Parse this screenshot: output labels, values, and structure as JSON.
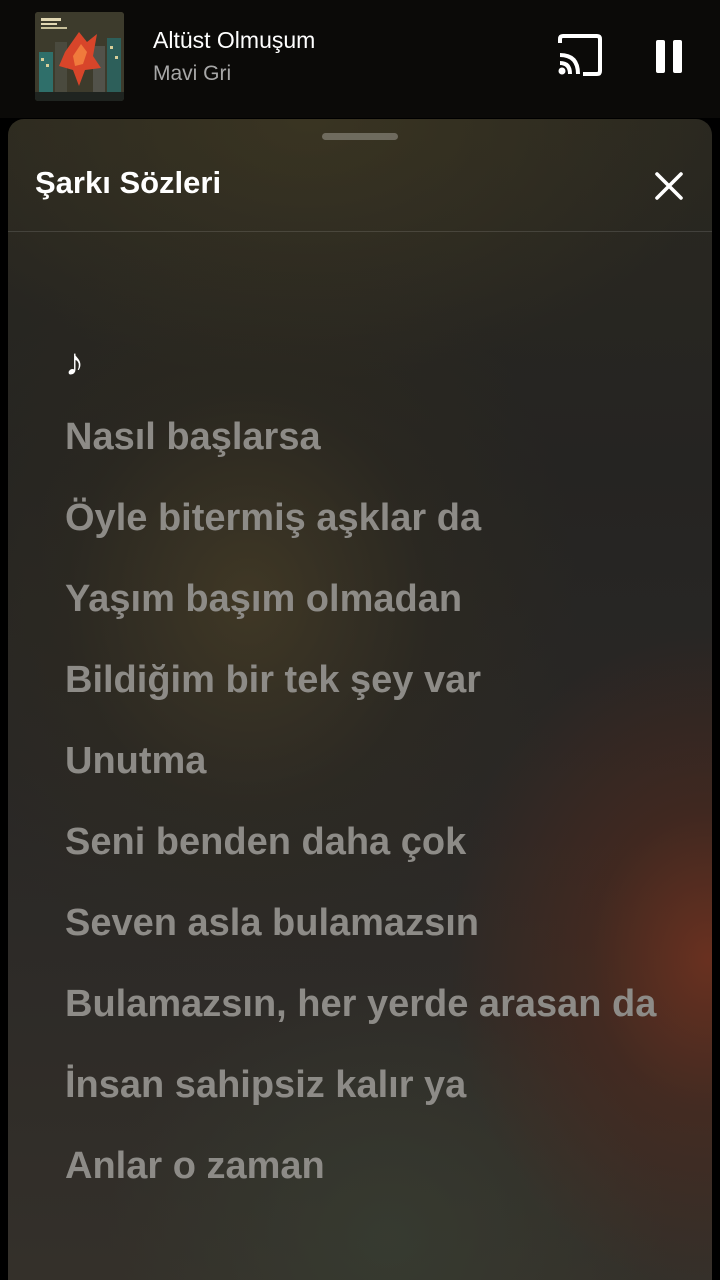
{
  "player": {
    "track_title": "Altüst Olmuşum",
    "artist": "Mavi Gri",
    "cast_icon": "cast-icon",
    "pause_icon": "pause-icon"
  },
  "lyrics_sheet": {
    "title": "Şarkı Sözleri",
    "close_icon": "close-icon",
    "note_symbol": "♪",
    "lines": [
      "Nasıl başlarsa",
      "Öyle bitermiş aşklar da",
      "Yaşım başım olmadan",
      "Bildiğim bir tek şey var",
      "Unutma",
      "Seni benden daha çok",
      "Seven asla bulamazsın",
      "Bulamazsın, her yerde arasan da",
      "İnsan sahipsiz kalır ya",
      "Anlar o zaman"
    ]
  },
  "colors": {
    "active_lyric": "#ffffff",
    "inactive_lyric": "#8d8b87",
    "mini_player_bg": "#0b0a08",
    "accent_warm": "#7a3a22"
  }
}
